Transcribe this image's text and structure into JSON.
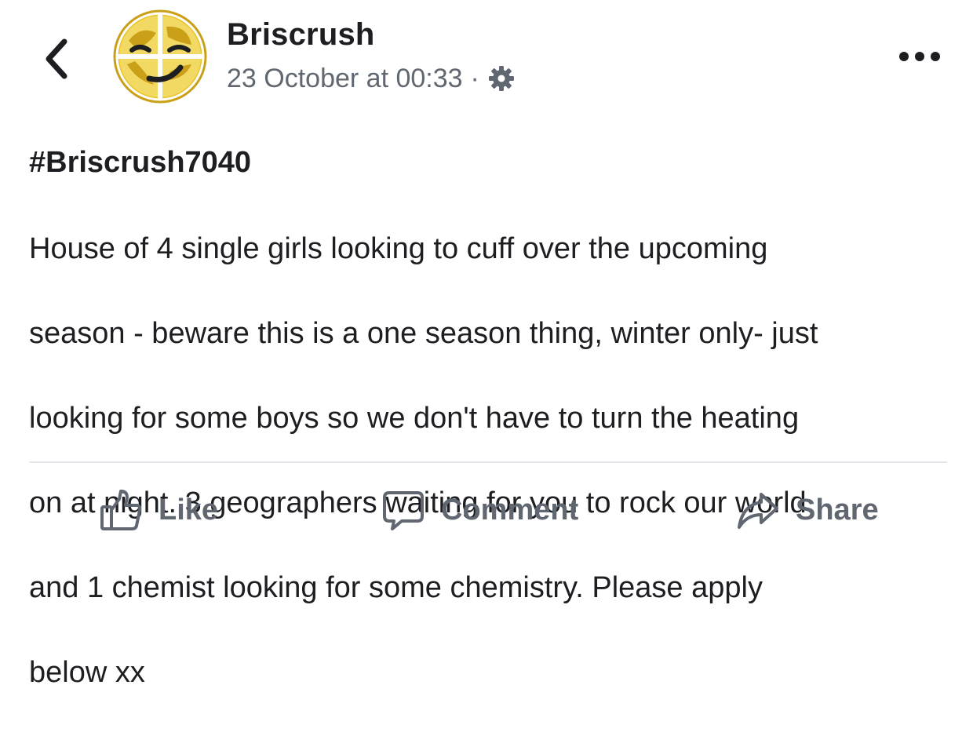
{
  "post": {
    "author": "Briscrush",
    "timestamp": "23 October at 00:33",
    "meta_separator": "·",
    "hashtag": "#Briscrush7040",
    "body_lines": [
      "House of 4 single girls looking to cuff over the upcoming",
      "season - beware this is a one season thing, winter only- just",
      "looking for some boys so we don't have to turn the heating",
      "on at night. 3 geographers waiting for you to rock our world,",
      "and 1 chemist looking for some chemistry. Please apply",
      "below xx"
    ]
  },
  "actions": {
    "like_label": "Like",
    "comment_label": "Comment",
    "share_label": "Share"
  },
  "icons": {
    "back": "chevron-left-icon",
    "privacy": "gear-icon",
    "more": "more-horizontal-icon",
    "like": "thumbs-up-icon",
    "comment": "comment-bubble-icon",
    "share": "share-arrow-icon"
  },
  "colors": {
    "text_primary": "#1c1e21",
    "text_secondary": "#606770",
    "avatar_gold": "#d8b21c",
    "divider": "#e4e6eb"
  }
}
